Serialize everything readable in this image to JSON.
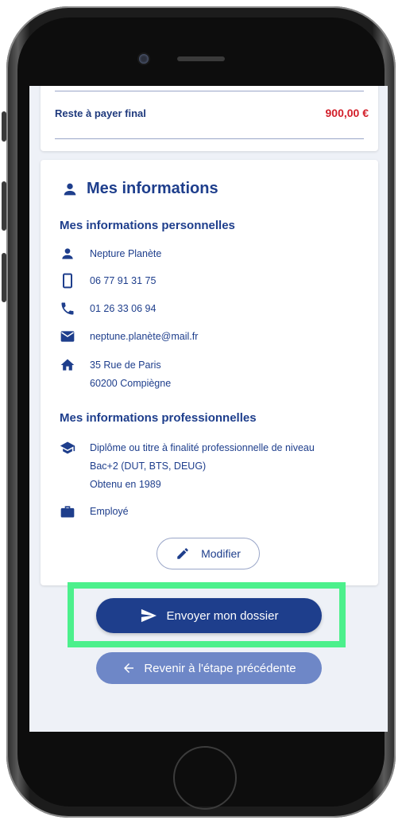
{
  "summary": {
    "reste_label": "Reste à payer final",
    "reste_value": "900,00 €"
  },
  "infos": {
    "title": "Mes informations",
    "personal_heading": "Mes informations personnelles",
    "name": "Nepture Planète",
    "mobile": "06 77 91 31 75",
    "phone": "01 26 33 06 94",
    "email": "neptune.planète@mail.fr",
    "address_line1": "35 Rue de Paris",
    "address_line2": "60200 Compiègne",
    "professional_heading": "Mes informations professionnelles",
    "diploma_line1": "Diplôme ou titre à finalité professionnelle de niveau",
    "diploma_line2": "Bac+2 (DUT, BTS, DEUG)",
    "diploma_line3": "Obtenu en 1989",
    "status": "Employé",
    "modify_label": "Modifier"
  },
  "actions": {
    "send_label": "Envoyer mon dossier",
    "back_label": "Revenir à l'étape précédente"
  },
  "colors": {
    "primary": "#1e3e8c",
    "secondary": "#6e87c7",
    "accent_red": "#d21f2a",
    "highlight": "#4cf08c"
  }
}
